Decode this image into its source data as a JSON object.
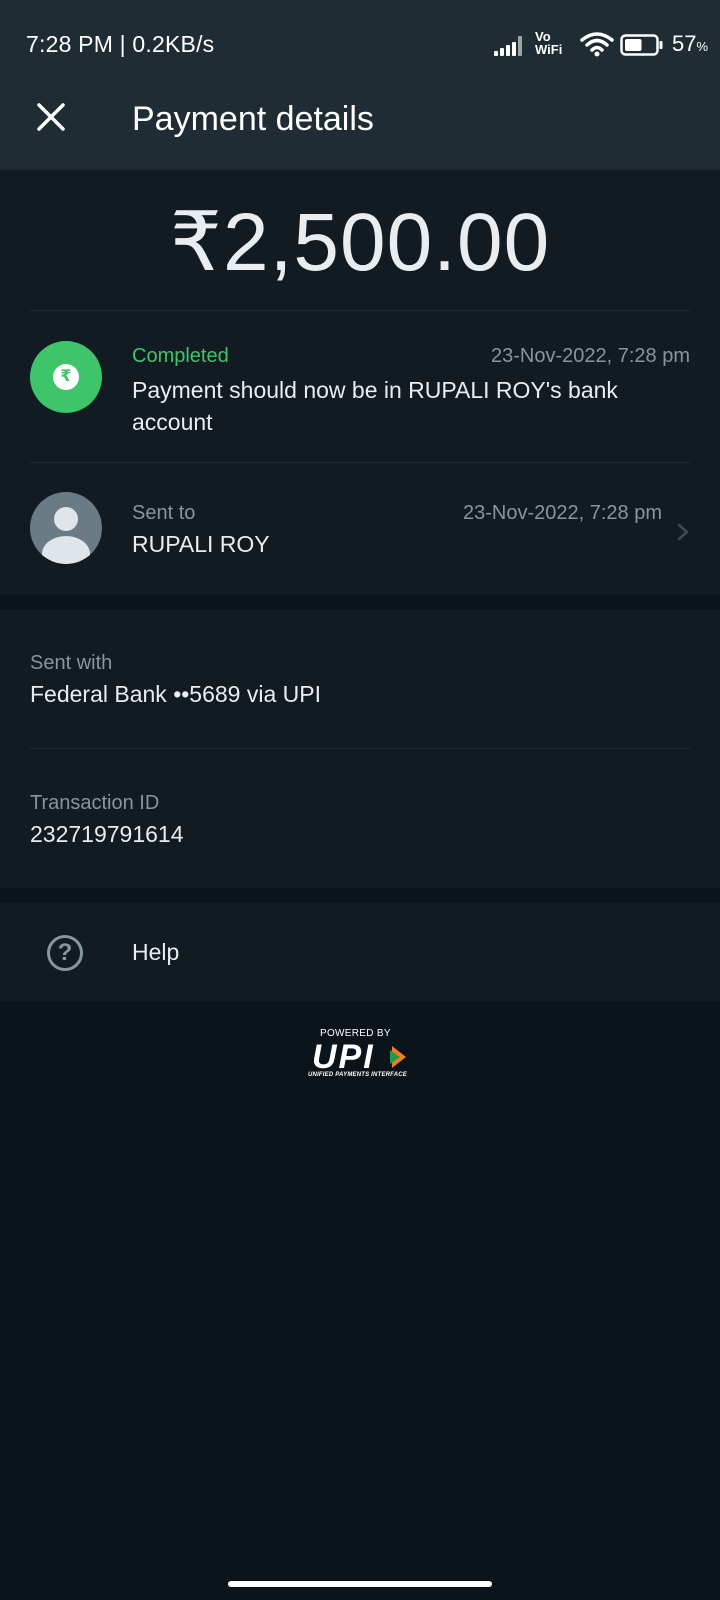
{
  "status_bar": {
    "time": "7:28 PM | 0.2KB/s",
    "network_top": "Vo",
    "network_bottom": "WiFi",
    "battery_percent": "57",
    "battery_unit": "%",
    "battery_level": 0.57
  },
  "header": {
    "title": "Payment details",
    "close_icon": "close-icon"
  },
  "payment": {
    "amount": "₹2,500.00",
    "status": {
      "label": "Completed",
      "datetime": "23-Nov-2022, 7:28 pm",
      "message": "Payment should now be in RUPALI ROY's bank account",
      "icon": "rupee-icon",
      "color": "#3ec56a"
    },
    "recipient": {
      "label": "Sent to",
      "name": "RUPALI ROY",
      "datetime": "23-Nov-2022, 7:28 pm"
    }
  },
  "details": {
    "sent_with_label": "Sent with",
    "sent_with_value": "Federal Bank ••5689 via UPI",
    "transaction_label": "Transaction ID",
    "transaction_value": "232719791614"
  },
  "help": {
    "label": "Help",
    "icon": "question-mark-icon"
  },
  "footer": {
    "powered_by": "POWERED BY",
    "upi_logo": "UPI",
    "upi_subtitle": "UNIFIED PAYMENTS INTERFACE"
  },
  "colors": {
    "background": "#0b131b",
    "card": "#111b21",
    "header": "#1f2c34",
    "accent_green": "#3ec56a"
  }
}
